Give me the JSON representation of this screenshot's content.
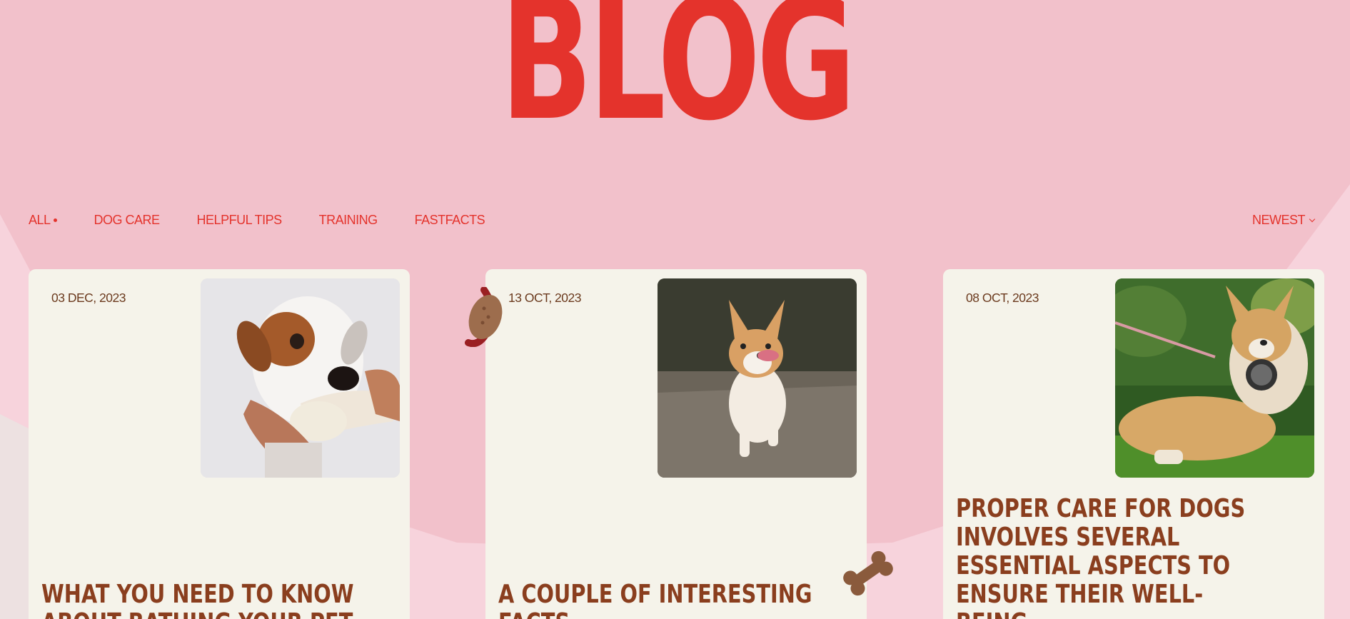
{
  "page": {
    "title": "BLOG",
    "colors": {
      "accent": "#e4332c",
      "background": "#f7d3dc",
      "card": "#f5f3ea",
      "headline": "#8a3e1e",
      "date": "#6b3a1e"
    }
  },
  "filters": {
    "items": [
      {
        "label": "ALL",
        "active": true
      },
      {
        "label": "DOG CARE",
        "active": false
      },
      {
        "label": "HELPFUL TIPS",
        "active": false
      },
      {
        "label": "TRAINING",
        "active": false
      },
      {
        "label": "FASTFACTS",
        "active": false
      }
    ],
    "sort_label": "NEWEST"
  },
  "posts": [
    {
      "date": "03 DEC, 2023",
      "title": "WHAT YOU NEED TO KNOW ABOUT BATHING YOUR PET.",
      "image": "dog-bath-photo"
    },
    {
      "date": "13 OCT, 2023",
      "title": "A COUPLE OF INTERESTING FACTS.",
      "image": "corgi-running-photo"
    },
    {
      "date": "08 OCT, 2023",
      "title": "PROPER CARE FOR DOGS INVOLVES SEVERAL ESSENTIAL ASPECTS TO ENSURE THEIR WELL-BEING.",
      "image": "corgi-grass-photo"
    }
  ],
  "decorations": {
    "hotdog": "hotdog-icon",
    "bone": "bone-icon"
  }
}
